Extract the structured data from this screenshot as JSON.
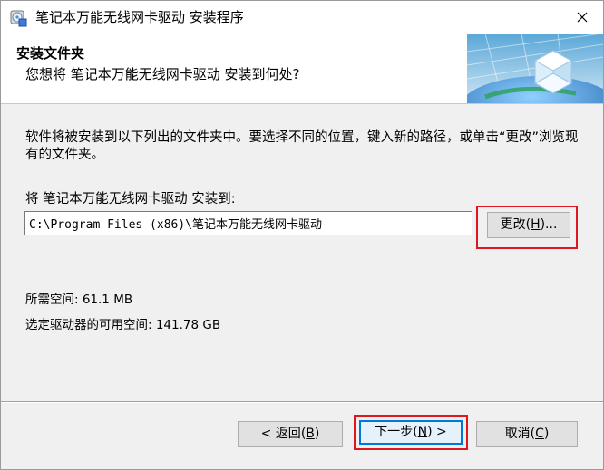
{
  "window": {
    "title": "笔记本万能无线网卡驱动 安装程序"
  },
  "header": {
    "title": "安装文件夹",
    "subtitle": "您想将 笔记本万能无线网卡驱动 安装到何处?"
  },
  "body": {
    "description": "软件将被安装到以下列出的文件夹中。要选择不同的位置，键入新的路径，或单击“更改”浏览现有的文件夹。",
    "install_label": "将 笔记本万能无线网卡驱动 安装到:",
    "install_path": "C:\\Program Files (x86)\\笔记本万能无线网卡驱动",
    "change_label": "更改",
    "change_key": "H",
    "space_required": "所需空间: 61.1 MB",
    "space_available": "选定驱动器的可用空间: 141.78 GB"
  },
  "footer": {
    "back_label": "返回",
    "back_key": "B",
    "next_label": "下一步",
    "next_key": "N",
    "cancel_label": "取消",
    "cancel_key": "C"
  },
  "icons": {
    "app": "installer-cd-icon",
    "close": "close-icon",
    "header": "globe-cube-graphic"
  },
  "colors": {
    "highlight": "#e0161e",
    "default_button_border": "#0078d7"
  }
}
